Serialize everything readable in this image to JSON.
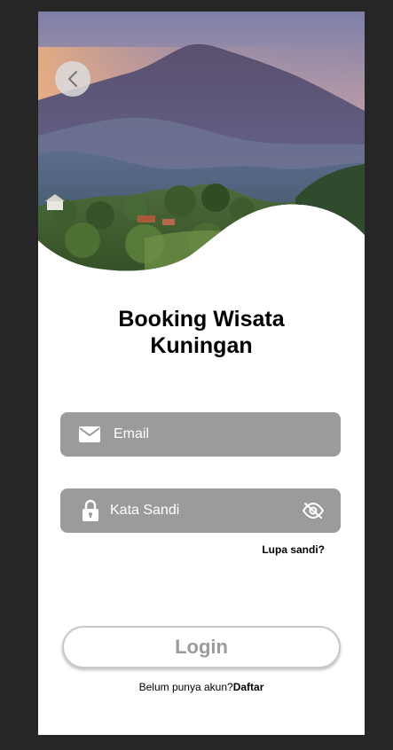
{
  "header": {
    "back_icon": "chevron-left-icon"
  },
  "title": {
    "line1": "Booking Wisata",
    "line2": "Kuningan"
  },
  "form": {
    "email": {
      "placeholder": "Email",
      "value": "",
      "icon": "envelope-icon"
    },
    "password": {
      "placeholder": "Kata Sandi",
      "value": "",
      "icon": "lock-icon",
      "toggle_icon": "eye-slash-icon"
    },
    "forgot_label": "Lupa sandi?",
    "login_label": "Login"
  },
  "footer": {
    "prompt": "Belum punya akun?",
    "signup_label": "Daftar"
  },
  "colors": {
    "field_bg": "#9b9b9b",
    "page_bg": "#262626",
    "card_bg": "#ffffff"
  }
}
